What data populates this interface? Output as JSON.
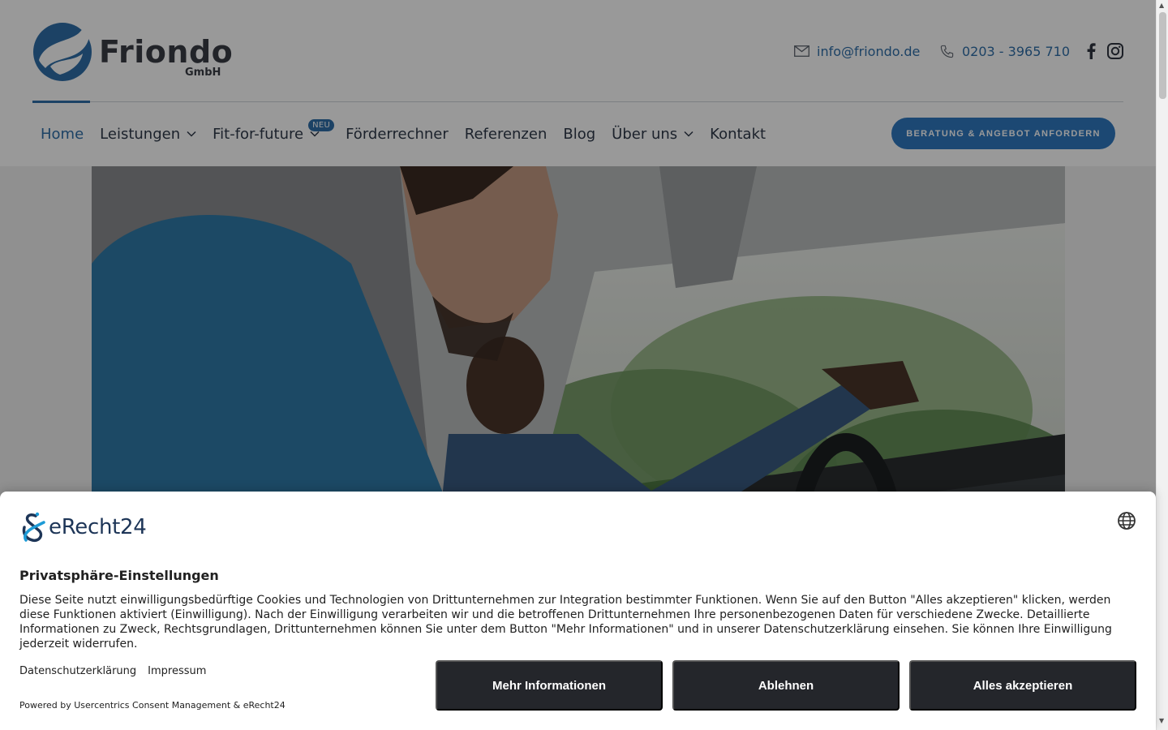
{
  "header": {
    "logo": {
      "name": "Friondo",
      "sub": "GmbH"
    },
    "contact": {
      "email": "info@friondo.de",
      "phone": "0203 - 3965 710"
    },
    "social": [
      "facebook-icon",
      "instagram-icon"
    ],
    "nav": [
      {
        "label": "Home",
        "active": true
      },
      {
        "label": "Leistungen",
        "dropdown": true
      },
      {
        "label": "Fit-for-future",
        "dropdown": true,
        "badge": "NEU"
      },
      {
        "label": "Förderrechner"
      },
      {
        "label": "Referenzen"
      },
      {
        "label": "Blog"
      },
      {
        "label": "Über uns",
        "dropdown": true
      },
      {
        "label": "Kontakt"
      }
    ],
    "cta": "BERATUNG & ANGEBOT ANFORDERN"
  },
  "consent": {
    "brand": "eRecht24",
    "title": "Privatsphäre-Einstellungen",
    "text": "Diese Seite nutzt einwilligungsbedürftige Cookies und Technologien von Drittunternehmen zur Integration bestimmter Funktionen. Wenn Sie auf den Button \"Alles akzeptieren\" klicken, werden diese Funktionen aktiviert (Einwilligung). Nach der Einwilligung verarbeiten wir und die betroffenen Drittunternehmen Ihre personenbezogenen Daten für verschiedene Zwecke. Detaillierte Informationen zu Zweck, Rechtsgrundlagen, Drittunternehmen können Sie unter dem Button \"Mehr Informationen\" und in unserer Datenschutzerklärung einsehen. Sie können Ihre Einwilligung jederzeit widerrufen.",
    "links": [
      "Datenschutzerklärung",
      "Impressum"
    ],
    "powered": "Powered by Usercentrics Consent Management & eRecht24",
    "buttons": {
      "more": "Mehr Informationen",
      "deny": "Ablehnen",
      "accept": "Alles akzeptieren"
    }
  },
  "colors": {
    "accent": "#2f6ea8",
    "cta": "#2f78c0",
    "button_dark": "#24262b"
  }
}
